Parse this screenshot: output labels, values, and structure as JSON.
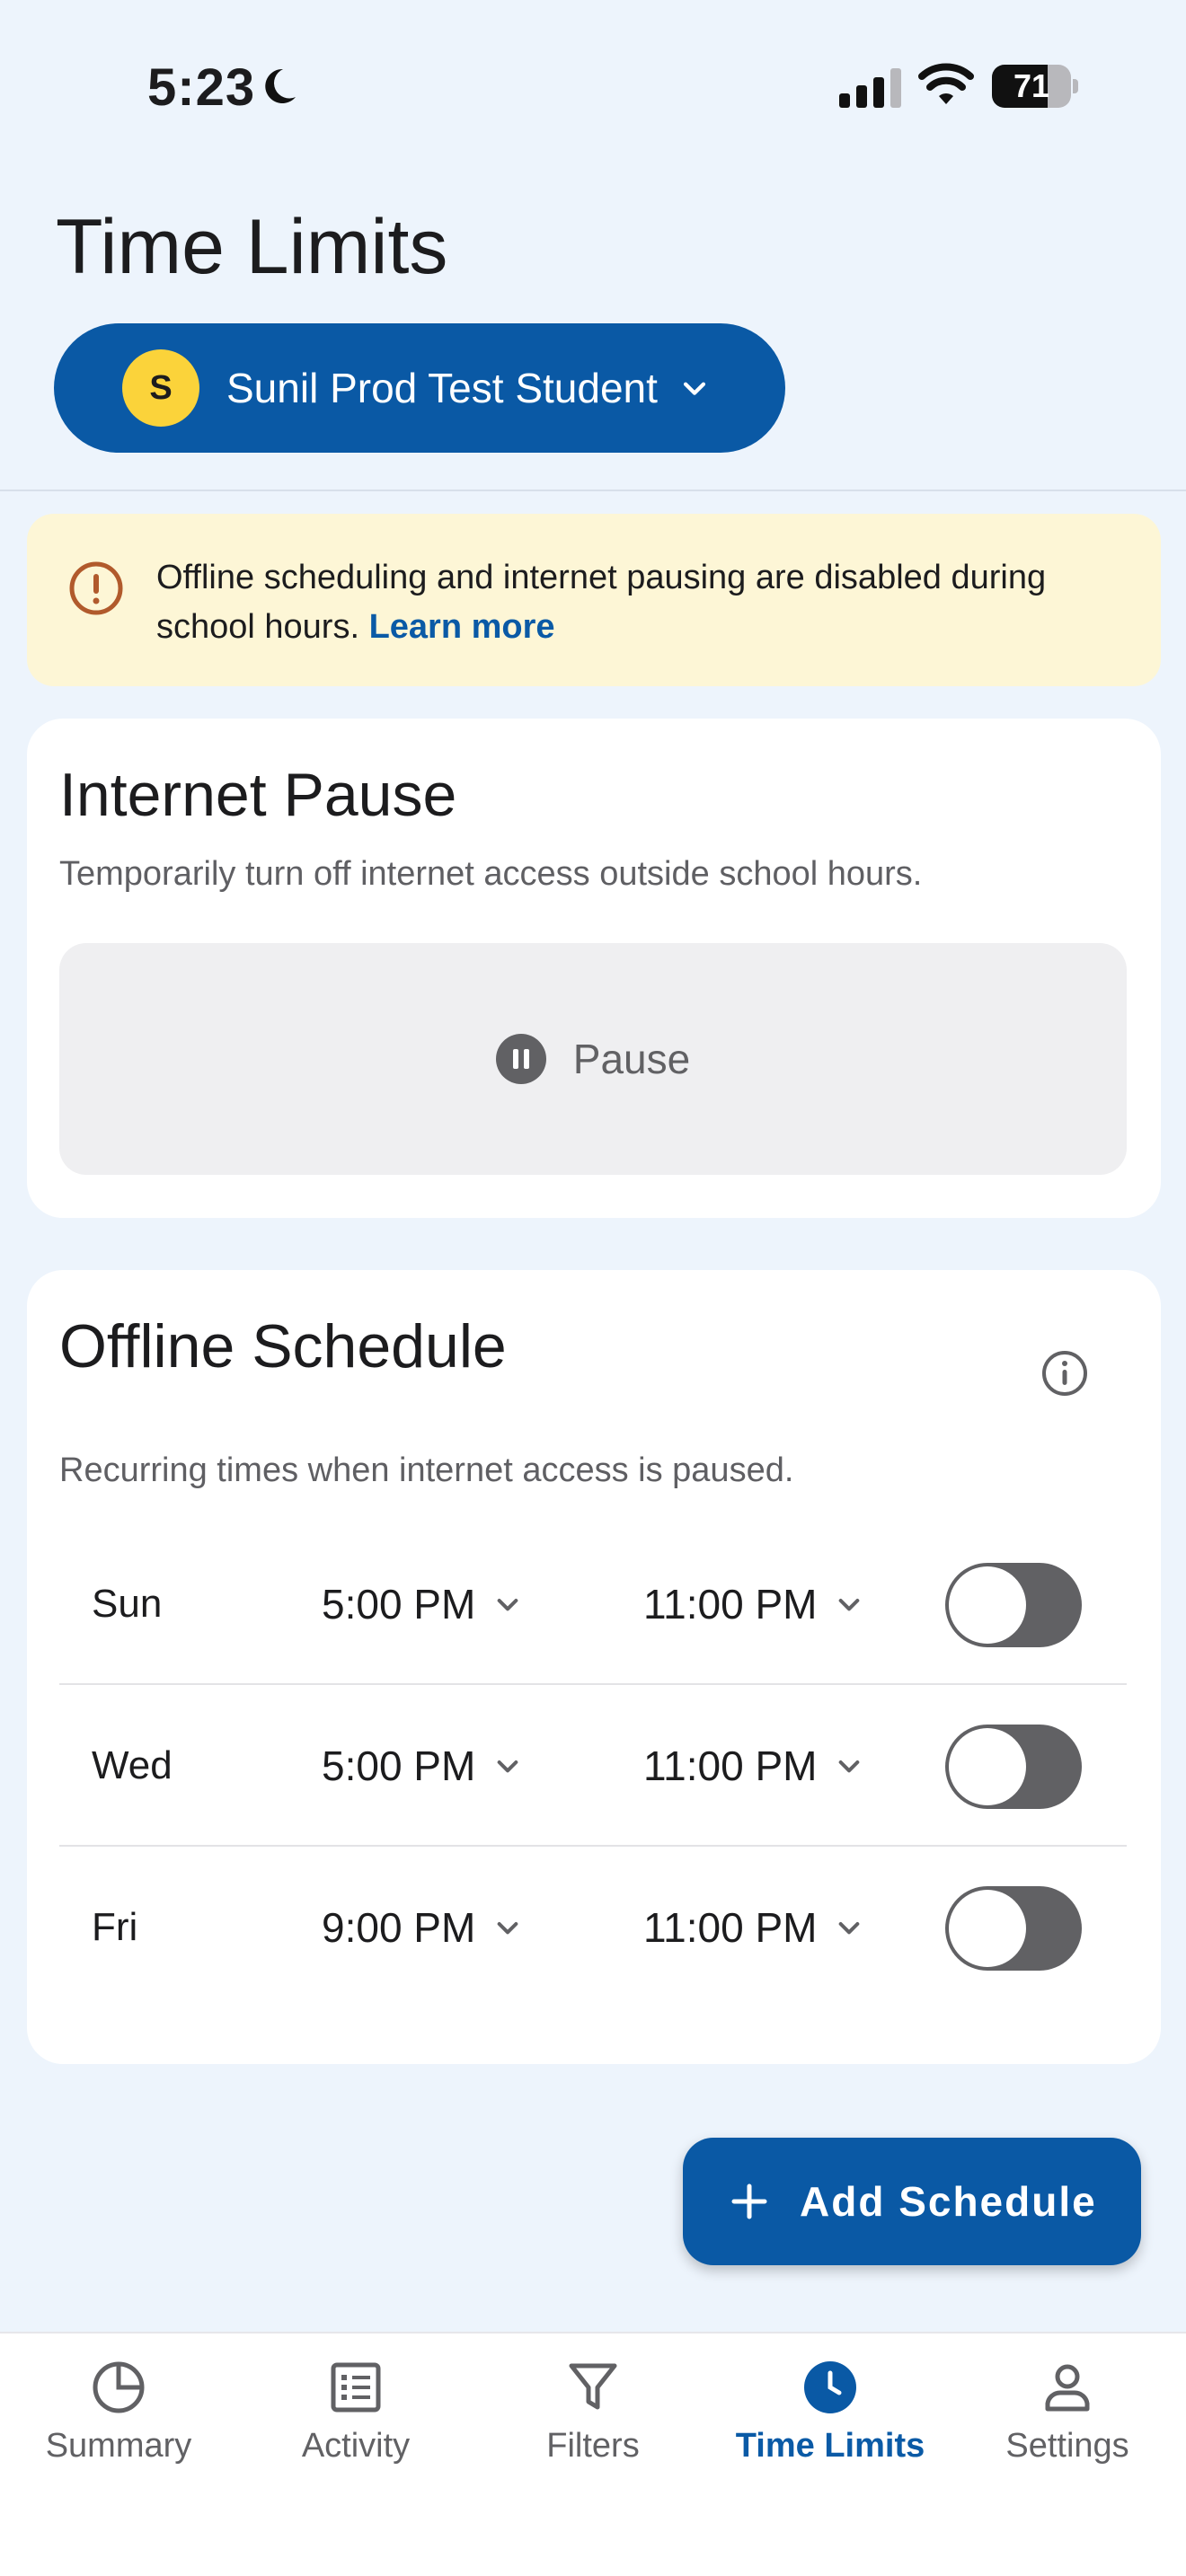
{
  "status_bar": {
    "time": "5:23",
    "battery": "71",
    "battery_level": 0.71
  },
  "header": {
    "title": "Time Limits"
  },
  "student_selector": {
    "avatar_initial": "S",
    "name": "Sunil Prod Test Student"
  },
  "notice": {
    "text": "Offline scheduling and internet pausing are disabled during school hours.",
    "link_label": "Learn more"
  },
  "internet_pause": {
    "title": "Internet Pause",
    "subtitle": "Temporarily turn off internet access outside school hours.",
    "button_label": "Pause"
  },
  "offline_schedule": {
    "title": "Offline Schedule",
    "subtitle": "Recurring times when internet access is paused.",
    "rows": [
      {
        "day": "Sun",
        "start": "5:00 PM",
        "end": "11:00 PM",
        "enabled": false
      },
      {
        "day": "Wed",
        "start": "5:00 PM",
        "end": "11:00 PM",
        "enabled": false
      },
      {
        "day": "Fri",
        "start": "9:00 PM",
        "end": "11:00 PM",
        "enabled": false
      }
    ]
  },
  "add_schedule": {
    "label": "Add Schedule"
  },
  "tabs": [
    {
      "label": "Summary",
      "icon": "pie-chart-icon"
    },
    {
      "label": "Activity",
      "icon": "list-icon"
    },
    {
      "label": "Filters",
      "icon": "filter-icon"
    },
    {
      "label": "Time Limits",
      "icon": "clock-icon",
      "active": true
    },
    {
      "label": "Settings",
      "icon": "person-icon"
    }
  ],
  "colors": {
    "brand": "#0a59a5",
    "link": "#0a5aa6",
    "notice_bg": "#fdf6d6",
    "avatar": "#fbd33a",
    "background": "#edf4fc"
  }
}
